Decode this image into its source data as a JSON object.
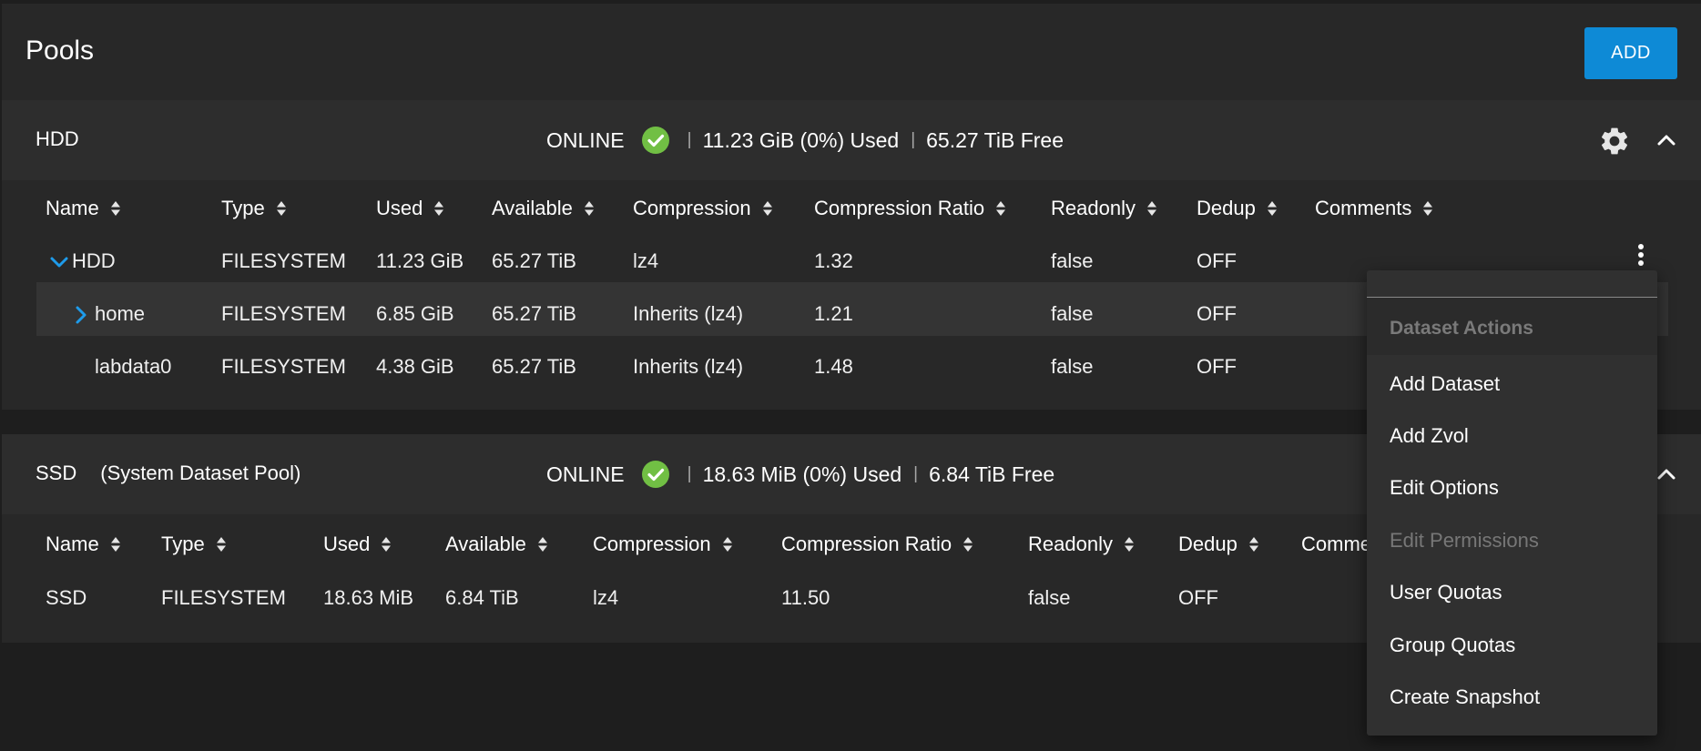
{
  "page": {
    "title": "Pools",
    "add_label": "ADD"
  },
  "colors": {
    "accent": "#0e8ad6",
    "online": "#71bf44",
    "background": "#1e1e1e",
    "card": "#282828"
  },
  "pools": [
    {
      "name": "HDD",
      "status": "ONLINE",
      "used": "11.23 GiB (0%) Used",
      "free": "65.27 TiB Free",
      "columns": [
        "Name",
        "Type",
        "Used",
        "Available",
        "Compression",
        "Compression Ratio",
        "Readonly",
        "Dedup",
        "Comments"
      ],
      "rows": [
        {
          "name": "HDD",
          "type": "FILESYSTEM",
          "used": "11.23 GiB",
          "available": "65.27 TiB",
          "compression": "lz4",
          "ratio": "1.32",
          "readonly": "false",
          "dedup": "OFF"
        },
        {
          "name": "home",
          "type": "FILESYSTEM",
          "used": "6.85 GiB",
          "available": "65.27 TiB",
          "compression": "Inherits (lz4)",
          "ratio": "1.21",
          "readonly": "false",
          "dedup": "OFF"
        },
        {
          "name": "labdata0",
          "type": "FILESYSTEM",
          "used": "4.38 GiB",
          "available": "65.27 TiB",
          "compression": "Inherits (lz4)",
          "ratio": "1.48",
          "readonly": "false",
          "dedup": "OFF"
        }
      ]
    },
    {
      "name": "SSD",
      "subtitle": "(System Dataset Pool)",
      "status": "ONLINE",
      "used": "18.63 MiB (0%) Used",
      "free": "6.84 TiB Free",
      "columns": [
        "Name",
        "Type",
        "Used",
        "Available",
        "Compression",
        "Compression Ratio",
        "Readonly",
        "Dedup",
        "Comme"
      ],
      "rows": [
        {
          "name": "SSD",
          "type": "FILESYSTEM",
          "used": "18.63 MiB",
          "available": "6.84 TiB",
          "compression": "lz4",
          "ratio": "11.50",
          "readonly": "false",
          "dedup": "OFF"
        }
      ]
    }
  ],
  "menu": {
    "header": "Dataset Actions",
    "items": [
      {
        "label": "Add Dataset",
        "enabled": true
      },
      {
        "label": "Add Zvol",
        "enabled": true
      },
      {
        "label": "Edit Options",
        "enabled": true
      },
      {
        "label": "Edit Permissions",
        "enabled": false
      },
      {
        "label": "User Quotas",
        "enabled": true
      },
      {
        "label": "Group Quotas",
        "enabled": true
      },
      {
        "label": "Create Snapshot",
        "enabled": true
      }
    ]
  },
  "icons": [
    "check-circle-icon",
    "gear-icon",
    "chevron-up-icon",
    "sort-icon",
    "chevron-down-icon",
    "chevron-right-icon",
    "more-vert-icon"
  ]
}
